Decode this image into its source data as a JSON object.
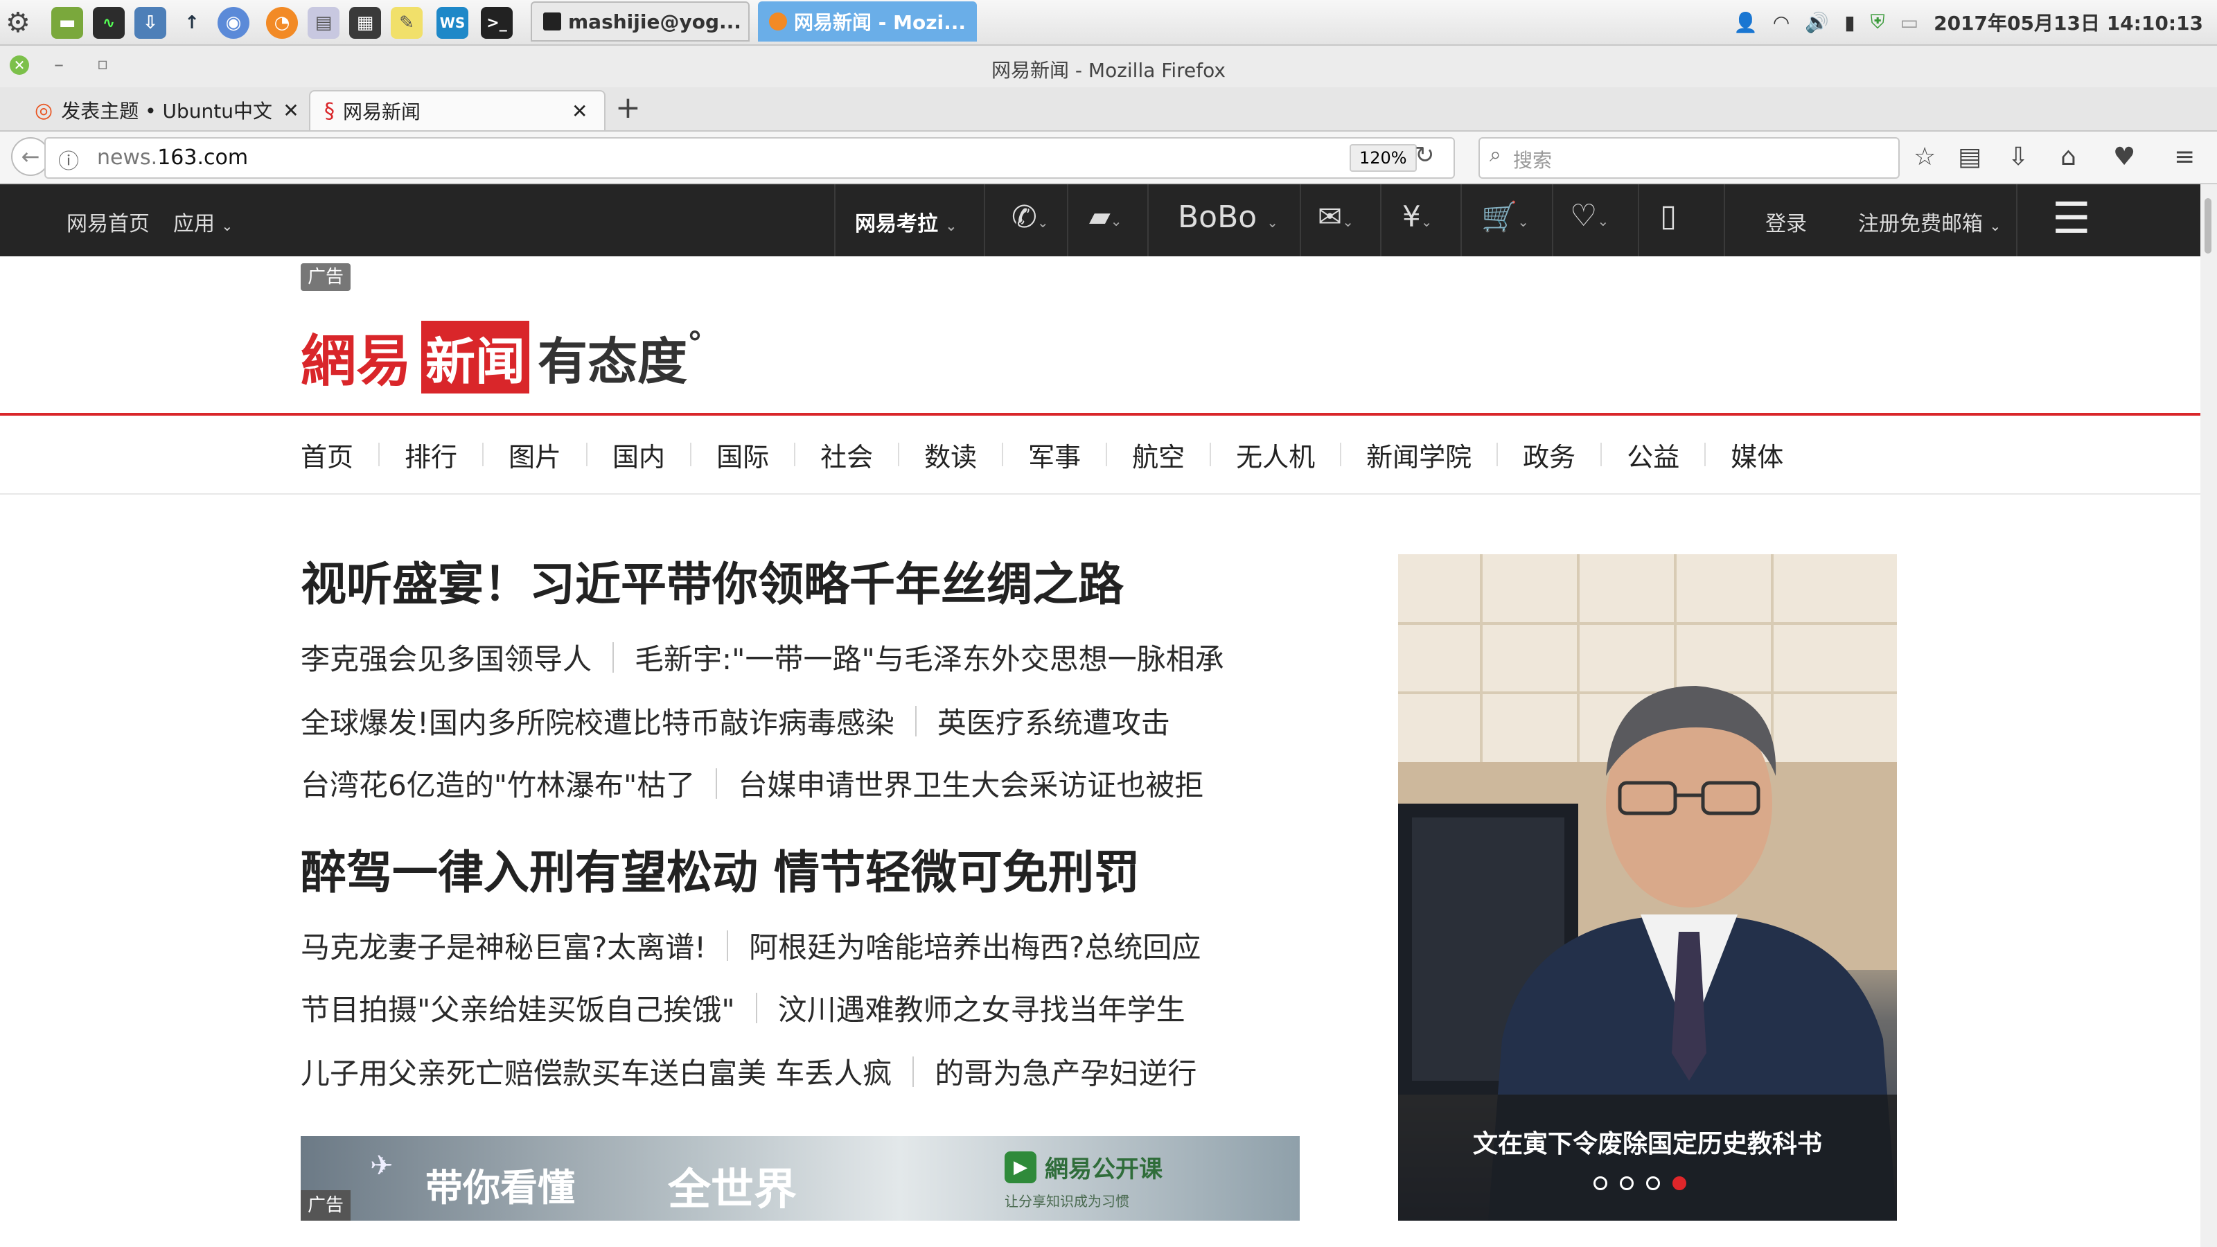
{
  "system_panel": {
    "tasks": [
      {
        "label": "mashijie@yog..."
      },
      {
        "label": "网易新闻 - Mozi..."
      }
    ],
    "clock": "2017年05月13日 14:10:13"
  },
  "window": {
    "title": "网易新闻 - Mozilla Firefox"
  },
  "tabs": [
    {
      "label": "发表主题 • Ubuntu中文"
    },
    {
      "label": "网易新闻"
    }
  ],
  "navbar": {
    "url_prefix": "news.",
    "url_domain": "163.com",
    "zoom": "120%",
    "search_placeholder": "搜索"
  },
  "site_bar": {
    "home": "网易首页",
    "apps": "应用",
    "kaola": "网易考拉",
    "bobo": "BoBo",
    "login": "登录",
    "register": "注册免费邮箱"
  },
  "ad_tag": "广告",
  "logo": {
    "wangyi": "網易",
    "news": "新闻",
    "slogan": "有态度"
  },
  "channels": [
    "首页",
    "排行",
    "图片",
    "国内",
    "国际",
    "社会",
    "数读",
    "军事",
    "航空",
    "无人机",
    "新闻学院",
    "政务",
    "公益",
    "媒体"
  ],
  "headlines": {
    "h1": "视听盛宴！习近平带你领略千年丝绸之路",
    "group1": [
      [
        "李克强会见多国领导人",
        "毛新宇:\"一带一路\"与毛泽东外交思想一脉相承"
      ],
      [
        "全球爆发!国内多所院校遭比特币敲诈病毒感染",
        "英医疗系统遭攻击"
      ],
      [
        "台湾花6亿造的\"竹林瀑布\"枯了",
        "台媒申请世界卫生大会采访证也被拒"
      ]
    ],
    "h2": "醉驾一律入刑有望松动 情节轻微可免刑罚",
    "group2": [
      [
        "马克龙妻子是神秘巨富?太离谱!",
        "阿根廷为啥能培养出梅西?总统回应"
      ],
      [
        "节目拍摄\"父亲给娃买饭自己挨饿\"",
        "汶川遇难教师之女寻找当年学生"
      ],
      [
        "儿子用父亲死亡赔偿款买车送白富美 车丢人疯",
        "的哥为急产孕妇逆行"
      ]
    ]
  },
  "banner": {
    "text1": "带你看懂",
    "text2": "全世界",
    "brand": "網易公开课",
    "brand_sub": "让分享知识成为习惯",
    "ad": "广告"
  },
  "photo": {
    "caption": "文在寅下令废除国定历史教科书",
    "dots": 4,
    "active_dot": 4
  }
}
